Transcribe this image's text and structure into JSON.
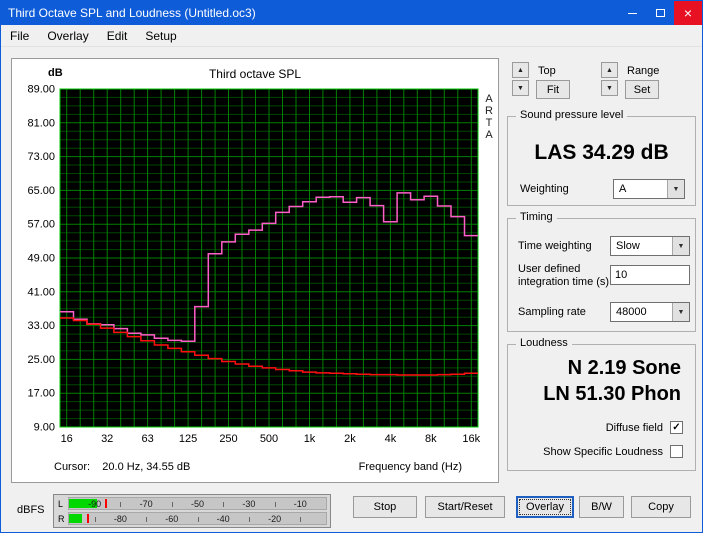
{
  "window": {
    "title": "Third Octave SPL and Loudness (Untitled.oc3)",
    "menu": [
      "File",
      "Overlay",
      "Edit",
      "Setup"
    ]
  },
  "scale_controls": {
    "top_label": "Top",
    "fit_button": "Fit",
    "range_label": "Range",
    "set_button": "Set"
  },
  "spl_group": {
    "title": "Sound pressure level",
    "value": "LAS 34.29 dB",
    "weighting_label": "Weighting",
    "weighting_value": "A"
  },
  "timing_group": {
    "title": "Timing",
    "time_weighting_label": "Time weighting",
    "time_weighting_value": "Slow",
    "integration_label_line1": "User defined",
    "integration_label_line2": "integration time (s)",
    "integration_value": "10",
    "sampling_label": "Sampling rate",
    "sampling_value": "48000"
  },
  "loudness_group": {
    "title": "Loudness",
    "sone_value": "N 2.19 Sone",
    "phon_value": "LN 51.30 Phon",
    "diffuse_label": "Diffuse field",
    "diffuse_checked": true,
    "specific_label": "Show Specific Loudness",
    "specific_checked": false
  },
  "meter": {
    "label": "dBFS",
    "range": [
      -100,
      0
    ],
    "left": {
      "channel": "L",
      "level_db": -89,
      "peak_db": -86,
      "scale": [
        -90,
        -70,
        -50,
        -30,
        -10
      ]
    },
    "right": {
      "channel": "R",
      "level_db": -95,
      "peak_db": -93,
      "scale": [
        -80,
        -60,
        -40,
        -20
      ]
    }
  },
  "action_buttons": {
    "stop": "Stop",
    "start_reset": "Start/Reset",
    "overlay": "Overlay",
    "bw": "B/W",
    "copy": "Copy"
  },
  "colors": {
    "titlebar": "#0e5cd8",
    "plot_background": "#000000",
    "grid_major": "#008000",
    "grid_minor": "#004600",
    "plot_border": "#00c800",
    "trace_magenta": "#ff5fc8",
    "trace_red": "#ff1010",
    "meter_fill": "#00d800",
    "meter_peak": "#ff0000"
  },
  "chart_data": {
    "type": "line",
    "title": "Third octave SPL",
    "ylabel": "dB",
    "xlabel": "Frequency band (Hz)",
    "cursor_text": "Cursor:    20.0 Hz, 34.55 dB",
    "watermark": "ARTA",
    "ylim": [
      9,
      89
    ],
    "ytick_step": 8,
    "grid": true,
    "yticks": [
      "89.00",
      "81.00",
      "73.00",
      "65.00",
      "57.00",
      "49.00",
      "41.00",
      "33.00",
      "25.00",
      "17.00",
      "9.00"
    ],
    "xticks": [
      "16",
      "32",
      "63",
      "125",
      "250",
      "500",
      "1k",
      "2k",
      "4k",
      "8k",
      "16k"
    ],
    "bands_hz": [
      16,
      20,
      25,
      31.5,
      40,
      50,
      63,
      80,
      100,
      125,
      160,
      200,
      250,
      315,
      400,
      500,
      630,
      800,
      1000,
      1250,
      1600,
      2000,
      2500,
      3150,
      4000,
      5000,
      6300,
      8000,
      10000,
      12500,
      16000
    ],
    "series": [
      {
        "name": "third-octave-spl-magenta",
        "color": "#ff5fc8",
        "values": [
          36.3,
          34.5,
          33.4,
          33.2,
          32.3,
          31.2,
          30.8,
          30.0,
          29.5,
          29.3,
          37.5,
          50.0,
          52.8,
          54.6,
          55.6,
          57.2,
          59.8,
          61.2,
          62.3,
          63.4,
          63.5,
          62.2,
          63.3,
          61.4,
          57.6,
          64.4,
          62.8,
          63.6,
          61.3,
          58.8,
          54.3
        ]
      },
      {
        "name": "overlay-red",
        "color": "#ff1010",
        "values": [
          34.8,
          34.2,
          33.3,
          32.4,
          31.4,
          30.4,
          29.4,
          28.4,
          27.6,
          26.8,
          26.0,
          25.2,
          24.5,
          23.9,
          23.4,
          23.0,
          22.6,
          22.3,
          22.0,
          21.8,
          21.7,
          21.6,
          21.5,
          21.4,
          21.4,
          21.3,
          21.3,
          21.3,
          21.4,
          21.5,
          21.7
        ]
      }
    ]
  }
}
